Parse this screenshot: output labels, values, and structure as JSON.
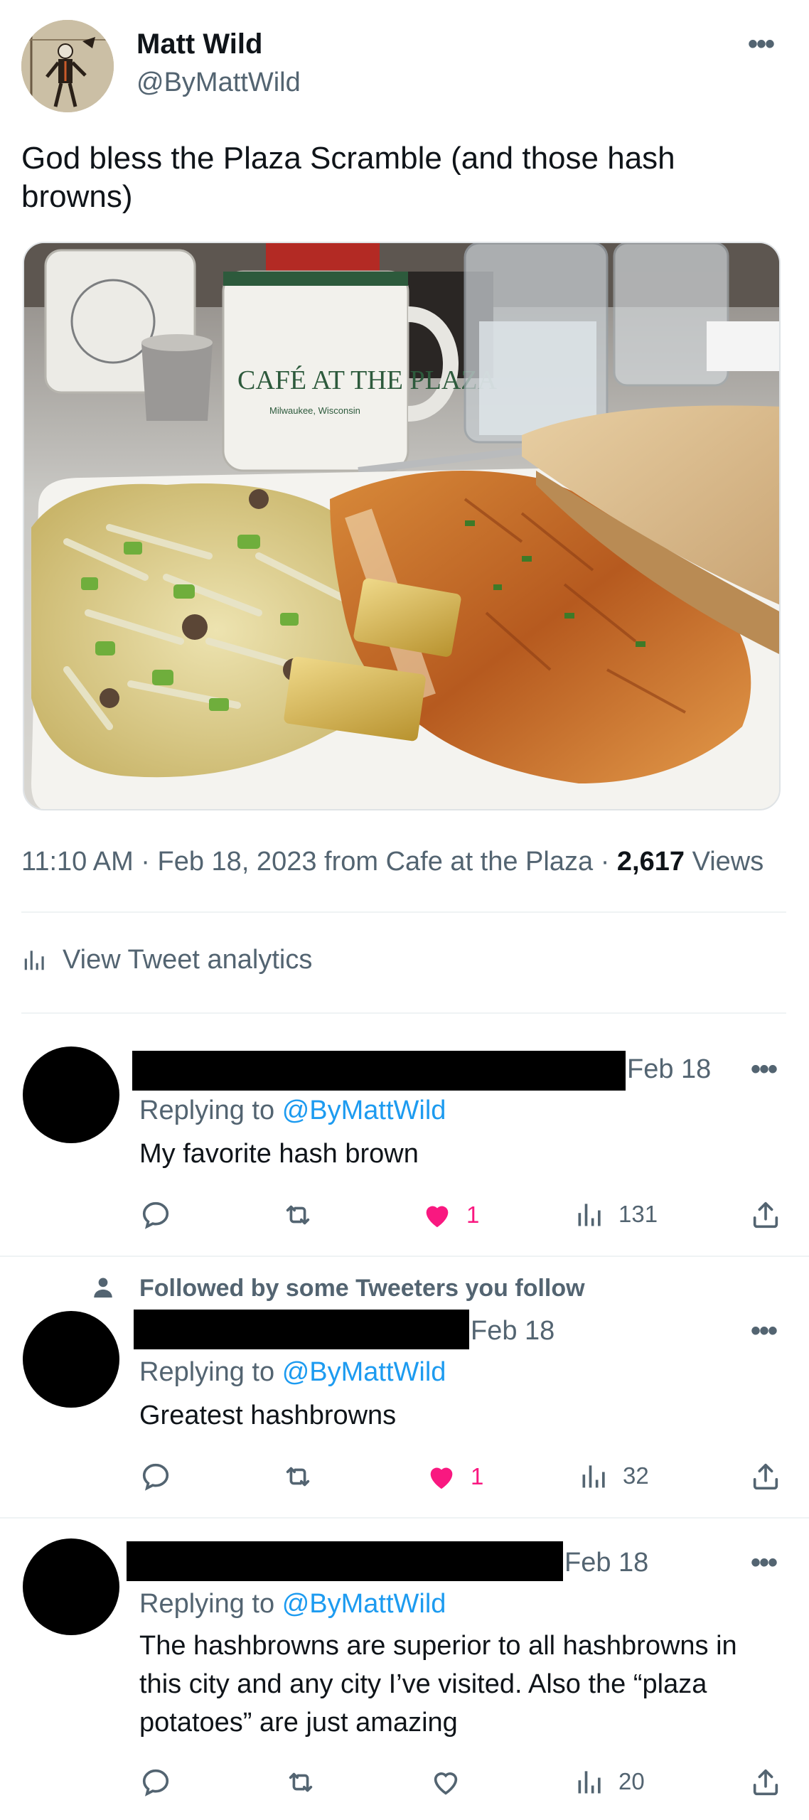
{
  "tweet": {
    "author_name": "Matt Wild",
    "author_handle": "@ByMattWild",
    "text": "God bless the Plaza Scramble (and those hash browns)",
    "photo": {
      "mug_text": "CAFÉ AT THE PLAZA",
      "mug_subtext": "Milwaukee, Wisconsin"
    },
    "time": "11:10 AM",
    "date": "Feb 18, 2023",
    "source": "from Cafe at the Plaza",
    "views_count": "2,617",
    "views_label": "Views",
    "analytics_label": "View Tweet analytics"
  },
  "replies": [
    {
      "date": "Feb 18",
      "replying_prefix": "Replying to",
      "replying_handle": "@ByMattWild",
      "text": "My favorite hash brown",
      "likes": "1",
      "liked": true,
      "views": "131"
    },
    {
      "follow_note": "Followed by some Tweeters you follow",
      "date": "Feb 18",
      "replying_prefix": "Replying to",
      "replying_handle": "@ByMattWild",
      "text": "Greatest hashbrowns",
      "likes": "1",
      "liked": true,
      "views": "32"
    },
    {
      "date": "Feb 18",
      "replying_prefix": "Replying to",
      "replying_handle": "@ByMattWild",
      "text": "The hashbrowns are superior to all hashbrowns in this city and any city I’ve visited. Also the “plaza potatoes” are just amazing",
      "likes": "",
      "liked": false,
      "views": "20"
    }
  ],
  "icons": {
    "more": "more-icon",
    "reply": "reply-icon",
    "retweet": "retweet-icon",
    "like": "heart-icon",
    "views": "views-icon",
    "share": "share-icon",
    "person": "person-icon"
  },
  "colors": {
    "text": "#0f1419",
    "secondary": "#536471",
    "link": "#1d9bf0",
    "like": "#f91880",
    "divider": "#eff3f4"
  }
}
